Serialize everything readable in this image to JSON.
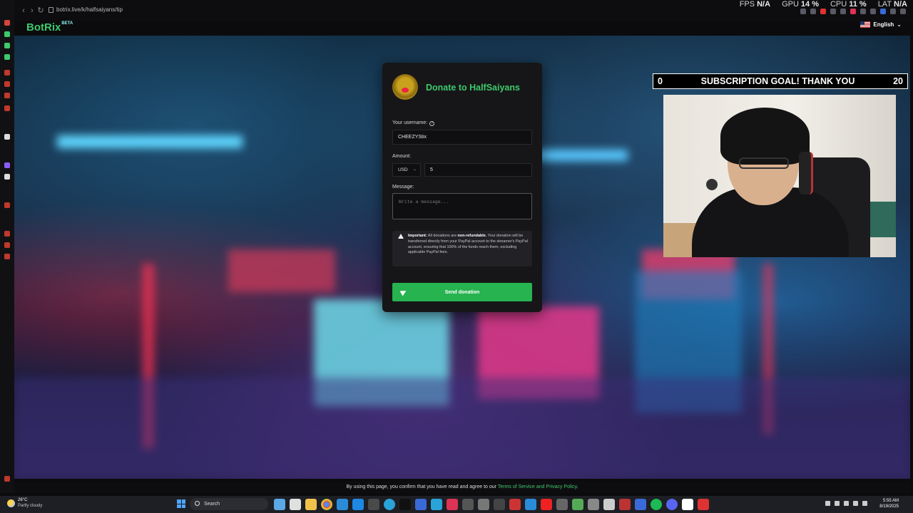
{
  "browser": {
    "url": "botrix.live/k/halfsaiyans/tip",
    "back": "‹",
    "forward": "›",
    "reload": "↻"
  },
  "perf": {
    "fps_label": "FPS",
    "fps_value": "N/A",
    "gpu_label": "GPU",
    "gpu_value": "14 %",
    "cpu_label": "CPU",
    "cpu_value": "11 %",
    "lat_label": "LAT",
    "lat_value": "N/A"
  },
  "header": {
    "logo": "BotRix",
    "logo_badge": "BETA",
    "language": "English",
    "language_chevron": "⌄"
  },
  "donate": {
    "title": "Donate to HalfSaiyans",
    "username_label": "Your username:",
    "help_glyph": "?",
    "username_value": "CHEEZYStix",
    "amount_label": "Amount:",
    "currency": "USD",
    "currency_chevron": "⌄",
    "amount_value": "5",
    "message_label": "Message:",
    "message_placeholder": "Write a message...",
    "notice_strong": "Important:",
    "notice_text_1": "All donations are",
    "notice_nonref": "non-refundable.",
    "notice_text_2": "Your donation will be transferred directly from your PayPal account to the streamer's PayPal account, ensuring that 100% of the funds reach them, excluding applicable PayPal fees.",
    "send_label": "Send donation"
  },
  "goal": {
    "left": "0",
    "title": "SUBSCRIPTION GOAL! THANK YOU",
    "right": "20"
  },
  "consent": {
    "text": "By using this page, you confirm that you have read and agree to our",
    "link": "Terms of Service and Privacy Policy",
    "end": "."
  },
  "taskbar": {
    "temp": "26°C",
    "weather": "Partly cloudy",
    "search": "Search",
    "time": "5:55 AM",
    "date": "8/19/2025"
  },
  "colors": {
    "brand_green": "#3ec96b",
    "button_green": "#27b34f"
  }
}
